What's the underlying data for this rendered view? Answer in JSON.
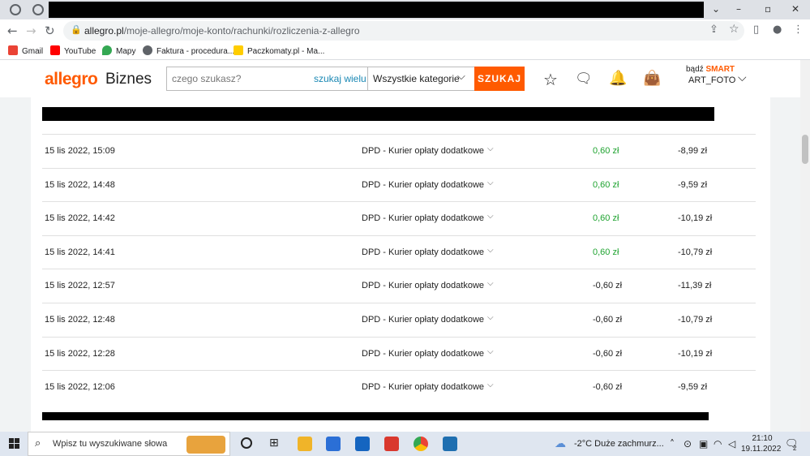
{
  "browser": {
    "url_host": "allegro.pl",
    "url_path": "/moje-allegro/moje-konto/rachunki/rozliczenia-z-allegro",
    "window_controls": {
      "minimize": "⌄",
      "restore": "–",
      "maximize": "▫",
      "close": "✕"
    },
    "bookmarks": [
      {
        "label": "Gmail",
        "icon": "gmail-icon",
        "color": "#ea4335"
      },
      {
        "label": "YouTube",
        "icon": "youtube-icon",
        "color": "#ff0000"
      },
      {
        "label": "Mapy",
        "icon": "maps-icon",
        "color": "#34a853"
      },
      {
        "label": "Faktura - procedura...",
        "icon": "globe-icon",
        "color": "#5f6368"
      },
      {
        "label": "Paczkomaty.pl - Ma...",
        "icon": "paczkomaty-icon",
        "color": "#ffcd00"
      }
    ]
  },
  "header": {
    "logo": "allegro",
    "logo_suffix": "Biznes",
    "search_placeholder": "czego szukasz?",
    "search_many": "szukaj wielu",
    "category": "Wszystkie kategorie",
    "search_button": "SZUKAJ",
    "smart_prefix": "bądź",
    "smart_label": "SMART",
    "user_name": "ART_FOTO",
    "accent_color": "#ff5a00"
  },
  "transactions": [
    {
      "date": "15 lis 2022, 15:09",
      "description": "DPD - Kurier opłaty dodatkowe",
      "amount": "0,60 zł",
      "positive": true,
      "balance": "-8,99 zł"
    },
    {
      "date": "15 lis 2022, 14:48",
      "description": "DPD - Kurier opłaty dodatkowe",
      "amount": "0,60 zł",
      "positive": true,
      "balance": "-9,59 zł"
    },
    {
      "date": "15 lis 2022, 14:42",
      "description": "DPD - Kurier opłaty dodatkowe",
      "amount": "0,60 zł",
      "positive": true,
      "balance": "-10,19 zł"
    },
    {
      "date": "15 lis 2022, 14:41",
      "description": "DPD - Kurier opłaty dodatkowe",
      "amount": "0,60 zł",
      "positive": true,
      "balance": "-10,79 zł"
    },
    {
      "date": "15 lis 2022, 12:57",
      "description": "DPD - Kurier opłaty dodatkowe",
      "amount": "-0,60 zł",
      "positive": false,
      "balance": "-11,39 zł"
    },
    {
      "date": "15 lis 2022, 12:48",
      "description": "DPD - Kurier opłaty dodatkowe",
      "amount": "-0,60 zł",
      "positive": false,
      "balance": "-10,79 zł"
    },
    {
      "date": "15 lis 2022, 12:28",
      "description": "DPD - Kurier opłaty dodatkowe",
      "amount": "-0,60 zł",
      "positive": false,
      "balance": "-10,19 zł"
    },
    {
      "date": "15 lis 2022, 12:06",
      "description": "DPD - Kurier opłaty dodatkowe",
      "amount": "-0,60 zł",
      "positive": false,
      "balance": "-9,59 zł"
    }
  ],
  "taskbar": {
    "search_placeholder": "Wpisz tu wyszukiwane słowa",
    "weather": "-2°C  Duże zachmurz...",
    "time": "21:10",
    "date": "19.11.2022",
    "notification_count": "2"
  }
}
